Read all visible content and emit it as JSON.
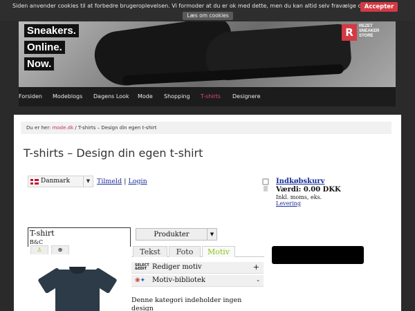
{
  "cookie_bar": {
    "text": "Siden anvender cookies til at forbedre brugeroplevelsen. Vi formoder at du er ok med dette, men du kan altid selv fravælge cookies.",
    "more_label": "Læs om cookies",
    "accept_label": "Accepter"
  },
  "banner": {
    "slogan": [
      "Sneakers.",
      "Online.",
      "Now."
    ],
    "brand_logo": "R",
    "brand_text": "REZET SNEAKER STORE"
  },
  "nav": {
    "items": [
      "Forsiden",
      "Modeblogs",
      "Dagens Look",
      "Mode",
      "Shopping",
      "T-shirts",
      "Designere"
    ],
    "active": "T-shirts"
  },
  "breadcrumb": {
    "prefix": "Du er her:",
    "home": "mode.dk",
    "separator": "/",
    "current": "T-shirts – Design din egen t-shirt"
  },
  "page_title": "T-shirts – Design din egen t-shirt",
  "language": {
    "selected": "Danmark",
    "flag": "flag-dk-icon"
  },
  "auth": {
    "register": "Tilmeld",
    "separator": "|",
    "login": "Login"
  },
  "cart": {
    "title": "Indkøbskurv",
    "value_label": "Værdi: 0.00 DKK",
    "vat_note": "Inkl. moms, eks.",
    "delivery_link": "Levering"
  },
  "designer": {
    "product_name": "T-shirt",
    "product_brand": "B&C",
    "products_dropdown": "Produkter",
    "tabs": [
      "Tekst",
      "Foto",
      "Motiv"
    ],
    "active_tab": "Motiv",
    "tools": [
      {
        "label": "Rediger motiv",
        "toggle": "+",
        "icon": "select-edit-icon"
      },
      {
        "label": "Motiv-bibliotek",
        "toggle": "-",
        "icon": "motif-library-icon"
      }
    ],
    "category_note": "Denne kategori indeholder ingen design",
    "tshirt_color": "#2d3b48"
  },
  "colors": {
    "accent_pink": "#e0457f",
    "accept_red": "#d33a44",
    "link_blue": "#1a2f9a",
    "active_tab_green": "#8cc21f"
  }
}
